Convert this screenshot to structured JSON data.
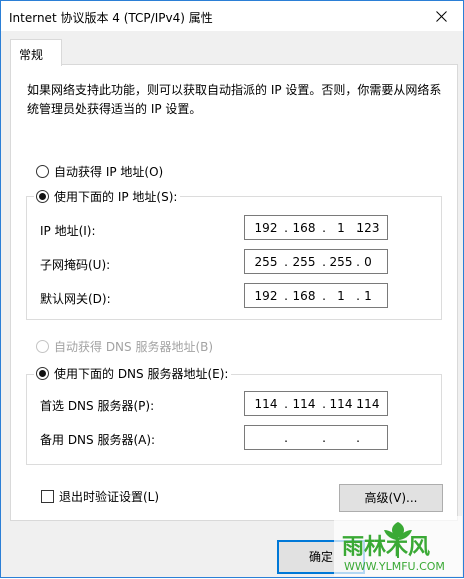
{
  "window": {
    "title": "Internet 协议版本 4 (TCP/IPv4) 属性"
  },
  "tabs": [
    {
      "label": "常规"
    }
  ],
  "description": "如果网络支持此功能，则可以获取自动指派的 IP 设置。否则，你需要从网络系统管理员处获得适当的 IP 设置。",
  "ip_section": {
    "auto_radio_label": "自动获得 IP 地址(O)",
    "auto_selected": false,
    "manual_radio_label": "使用下面的 IP 地址(S):",
    "manual_selected": true,
    "fields": [
      {
        "label": "IP 地址(I):",
        "octets": [
          "192",
          "168",
          "1",
          "123"
        ]
      },
      {
        "label": "子网掩码(U):",
        "octets": [
          "255",
          "255",
          "255",
          "0"
        ]
      },
      {
        "label": "默认网关(D):",
        "octets": [
          "192",
          "168",
          "1",
          "1"
        ]
      }
    ]
  },
  "dns_section": {
    "auto_radio_label": "自动获得 DNS 服务器地址(B)",
    "auto_enabled": false,
    "manual_radio_label": "使用下面的 DNS 服务器地址(E):",
    "manual_selected": true,
    "fields": [
      {
        "label": "首选 DNS 服务器(P):",
        "octets": [
          "114",
          "114",
          "114",
          "114"
        ]
      },
      {
        "label": "备用 DNS 服务器(A):",
        "octets": [
          "",
          "",
          "",
          ""
        ]
      }
    ]
  },
  "validate_checkbox": {
    "label": "退出时验证设置(L)",
    "checked": false
  },
  "buttons": {
    "advanced": "高级(V)...",
    "ok": "确定"
  },
  "watermark": {
    "text": "雨林木风",
    "url_text": "WWW.YLMFU.COM"
  },
  "colors": {
    "window_border": "#2b7fd6",
    "ok_border": "#0078d7",
    "watermark_green": "#3aa935"
  }
}
